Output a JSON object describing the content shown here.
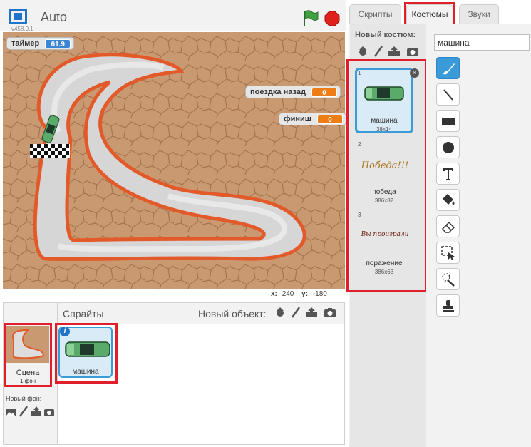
{
  "stage": {
    "title": "Auto",
    "version": "v458.0.1",
    "monitors": {
      "timer": {
        "label": "таймер",
        "value": "61.9"
      },
      "reverse": {
        "label": "поездка назад",
        "value": "0"
      },
      "finish": {
        "label": "финиш",
        "value": "0"
      }
    },
    "coords": {
      "x_label": "x:",
      "x_value": "240",
      "y_label": "y:",
      "y_value": "-180"
    }
  },
  "sprites_panel": {
    "title": "Спрайты",
    "new_object_label": "Новый объект:",
    "scene": {
      "name": "Сцена",
      "count": "1 фон"
    },
    "new_backdrop_label": "Новый фон:",
    "sprites": [
      {
        "name": "машина"
      }
    ]
  },
  "tabs": [
    {
      "label": "Скрипты"
    },
    {
      "label": "Костюмы"
    },
    {
      "label": "Звуки"
    }
  ],
  "costumes": {
    "new_costume_label": "Новый костюм:",
    "items": [
      {
        "num": "1",
        "name": "машина",
        "size": "38x14"
      },
      {
        "num": "2",
        "name": "победа",
        "size": "386x82",
        "image_text": "Победа!!!"
      },
      {
        "num": "3",
        "name": "поражение",
        "size": "386x63",
        "image_text": "Вы проиграли"
      }
    ]
  },
  "paint_editor": {
    "costume_name_value": "машина",
    "tools": [
      "brush-icon",
      "line-icon",
      "rectangle-icon",
      "ellipse-icon",
      "text-icon",
      "fill-icon",
      "eraser-icon",
      "select-icon",
      "magic-select-icon",
      "stamp-icon"
    ]
  },
  "colors": {
    "highlight": "#e01e2c",
    "selected_blue": "#3b9bd9",
    "track_outline": "#e35a2a",
    "sand": "#c99a72"
  }
}
